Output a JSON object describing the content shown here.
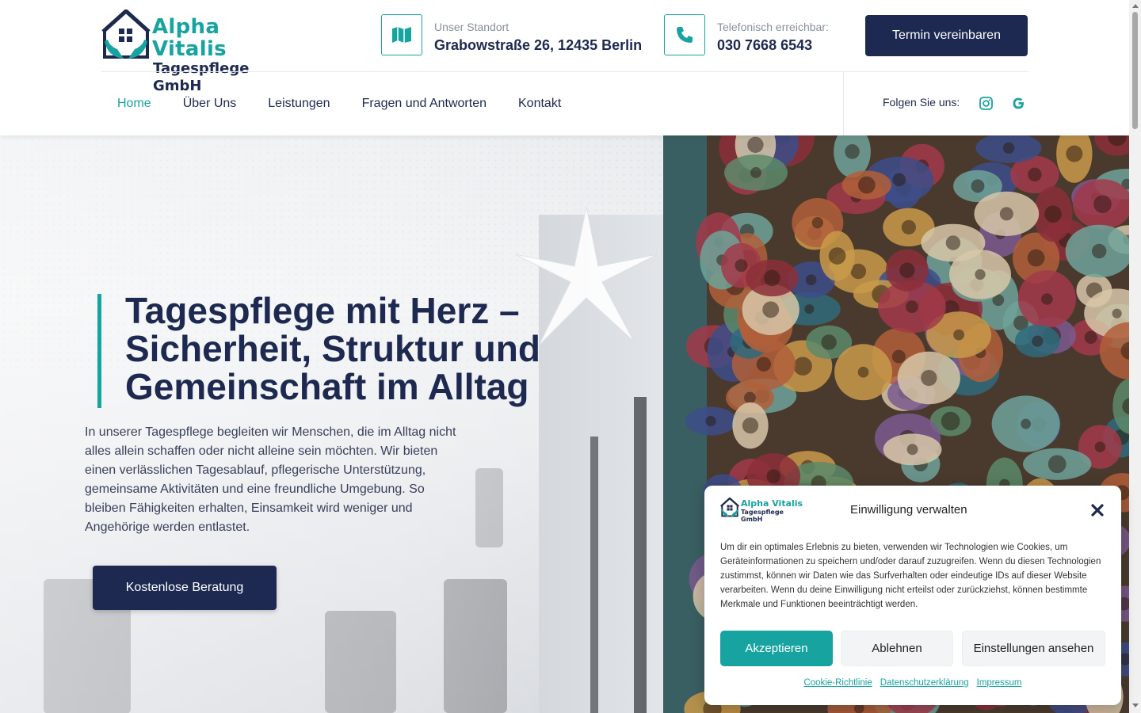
{
  "brand": {
    "name_line1": "Alpha Vitalis",
    "name_line2": "Tagespflege GmbH",
    "accent": "#17a3a0",
    "navy": "#1d2950"
  },
  "header": {
    "location": {
      "icon": "map-icon",
      "label": "Unser Standort",
      "value": "Grabowstraße 26, 12435 Berlin"
    },
    "phone": {
      "icon": "phone-icon",
      "label": "Telefonisch erreichbar:",
      "value": "030 7668 6543"
    },
    "cta_label": "Termin vereinbaren"
  },
  "nav": {
    "items": [
      {
        "label": "Home",
        "active": true
      },
      {
        "label": "Über Uns"
      },
      {
        "label": "Leistungen"
      },
      {
        "label": "Fragen und Antworten"
      },
      {
        "label": "Kontakt"
      }
    ],
    "follow_label": "Folgen Sie uns:",
    "social": [
      "instagram-icon",
      "google-icon"
    ]
  },
  "hero": {
    "headline_line1": "Tagespflege mit Herz –",
    "headline_line2": "Sicherheit, Struktur und",
    "headline_line3": "Gemeinschaft im Alltag",
    "text": "In unserer Tagespflege begleiten wir Menschen, die im Alltag nicht alles allein schaffen oder nicht alleine sein möchten. Wir bieten einen verlässlichen Tagesablauf, pflegerische Unterstützung, gemeinsame Aktivitäten und eine freundliche Umgebung. So bleiben Fähigkeiten erhalten, Einsamkeit wird weniger und Angehörige werden entlastet.",
    "button_label": "Kostenlose Beratung"
  },
  "cookie": {
    "logo_line1": "Alpha Vitalis",
    "logo_line2": "Tagespflege GmbH",
    "title": "Einwilligung verwalten",
    "body": "Um dir ein optimales Erlebnis zu bieten, verwenden wir Technologien wie Cookies, um Geräteinformationen zu speichern und/oder darauf zuzugreifen. Wenn du diesen Technologien zustimmst, können wir Daten wie das Surfverhalten oder eindeutige IDs auf dieser Website verarbeiten. Wenn du deine Einwilligung nicht erteilst oder zurückziehst, können bestimmte Merkmale und Funktionen beeinträchtigt werden.",
    "accept": "Akzeptieren",
    "deny": "Ablehnen",
    "preferences": "Einstellungen ansehen",
    "links": [
      "Cookie-Richtlinie",
      "Datenschutzerklärung",
      "Impressum"
    ]
  }
}
